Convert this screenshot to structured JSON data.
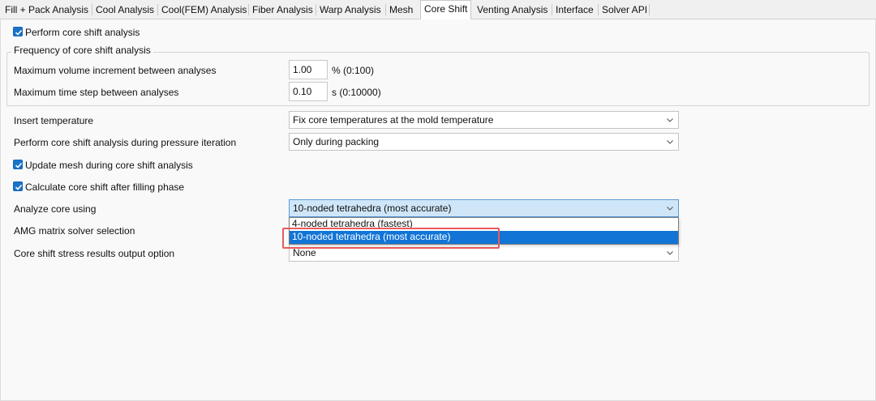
{
  "tabs": [
    {
      "label": "Fill + Pack Analysis"
    },
    {
      "label": "Cool Analysis"
    },
    {
      "label": "Cool(FEM) Analysis"
    },
    {
      "label": "Fiber Analysis"
    },
    {
      "label": "Warp Analysis"
    },
    {
      "label": "Mesh"
    },
    {
      "label": "Core Shift"
    },
    {
      "label": "Venting Analysis"
    },
    {
      "label": "Interface"
    },
    {
      "label": "Solver API"
    }
  ],
  "active_tab": "Core Shift",
  "perform_core_shift": {
    "label": "Perform core shift analysis",
    "checked": true
  },
  "frequency": {
    "title": "Frequency of core shift analysis",
    "max_volume": {
      "label": "Maximum volume increment between analyses",
      "value": "1.00",
      "unit": "% (0:100)"
    },
    "max_time": {
      "label": "Maximum time step between analyses",
      "value": "0.10",
      "unit": "s (0:10000)"
    }
  },
  "insert_temperature": {
    "label": "Insert temperature",
    "value": "Fix core temperatures at the mold temperature"
  },
  "pressure_iteration": {
    "label": "Perform core shift analysis during pressure iteration",
    "value": "Only during packing"
  },
  "update_mesh": {
    "label": "Update mesh during core shift analysis",
    "checked": true
  },
  "calc_after_filling": {
    "label": "Calculate core shift after filling phase",
    "checked": true
  },
  "analyze_core": {
    "label": "Analyze core using",
    "value": "10-noded tetrahedra (most accurate)",
    "options": [
      "4-noded tetrahedra (fastest)",
      "10-noded tetrahedra (most accurate)"
    ],
    "selected_index": 1
  },
  "amg_solver": {
    "label": "AMG matrix solver selection"
  },
  "stress_output": {
    "label": "Core shift stress results output option",
    "value": "None"
  },
  "colors": {
    "accent": "#1275d6",
    "checkbox": "#1a73c9",
    "annotation": "#e85b5b"
  }
}
